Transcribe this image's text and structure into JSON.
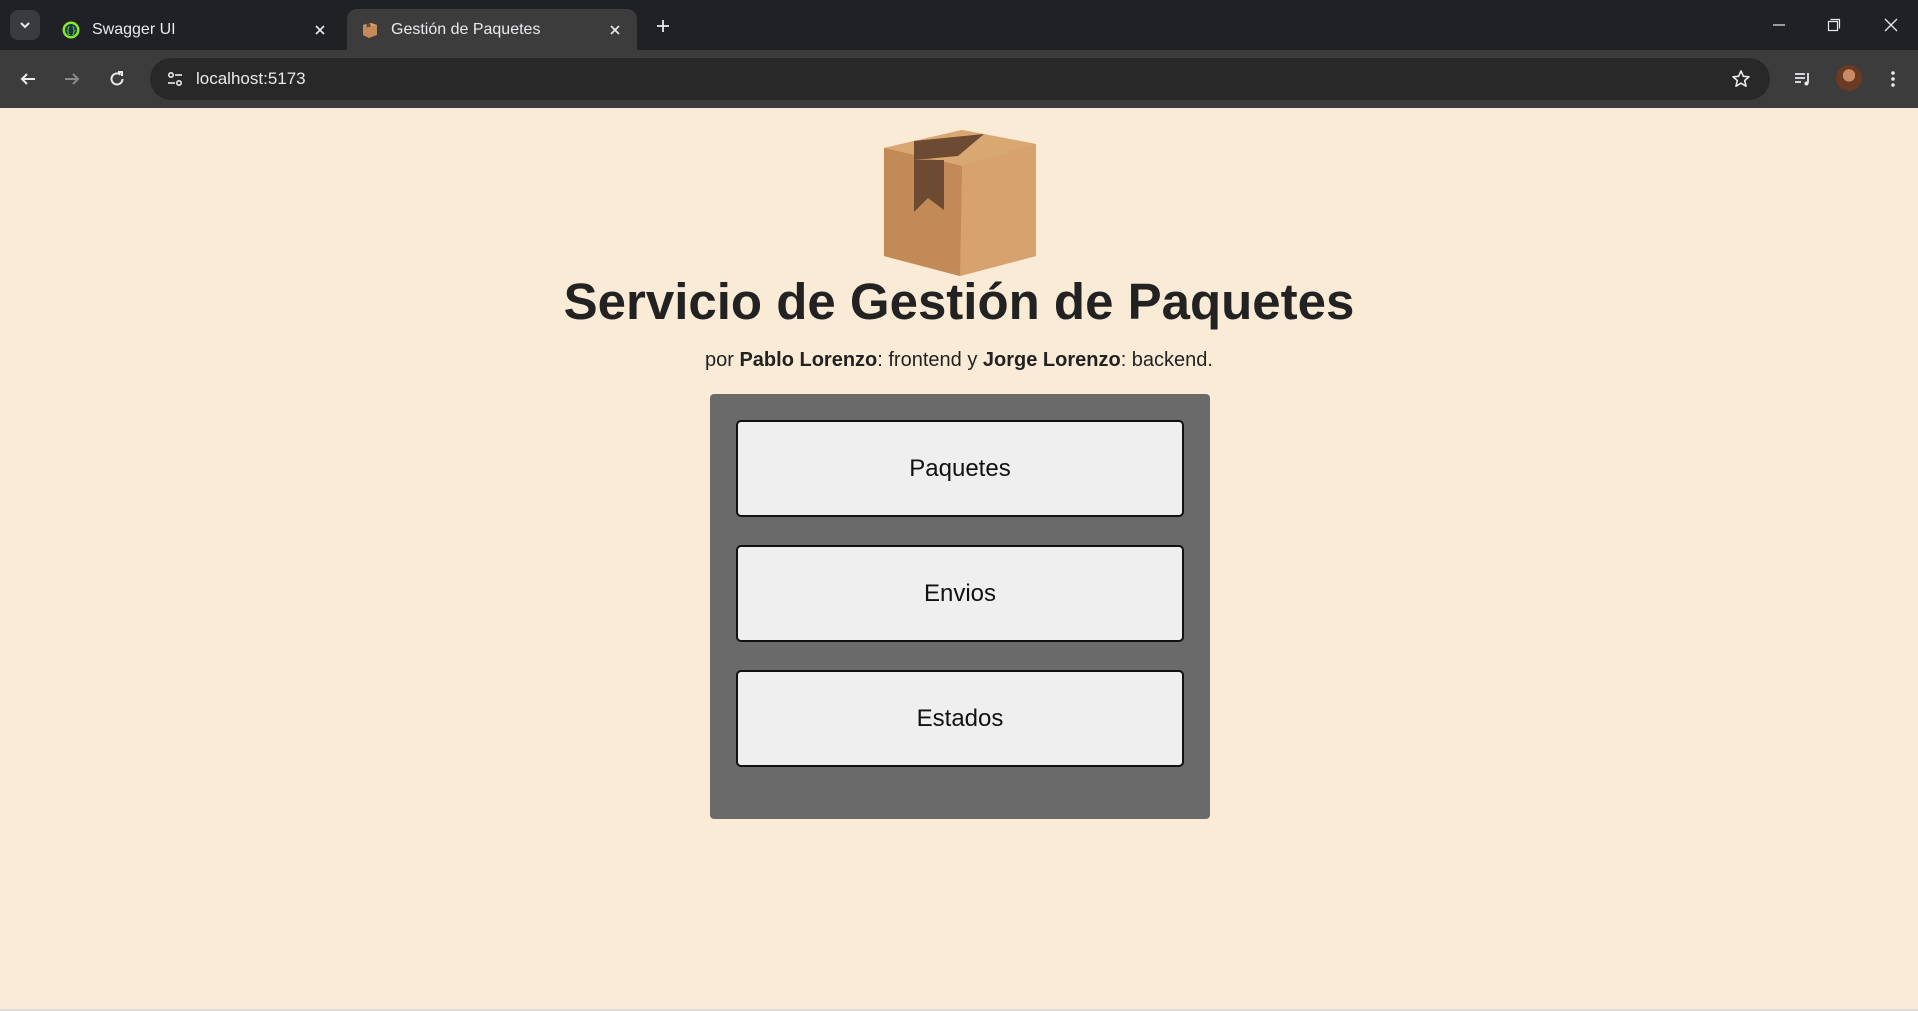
{
  "browser": {
    "tabs": [
      {
        "title": "Swagger UI",
        "active": false
      },
      {
        "title": "Gestión de Paquetes",
        "active": true
      }
    ],
    "url": "localhost:5173"
  },
  "page": {
    "logo_icon": "package-box-icon",
    "title": "Servicio de Gestión de Paquetes",
    "credits": {
      "prefix": "por ",
      "author1": "Pablo Lorenzo",
      "role1": ": frontend y ",
      "author2": "Jorge Lorenzo",
      "role2": ": backend."
    },
    "menu": [
      {
        "label": "Paquetes"
      },
      {
        "label": "Envios"
      },
      {
        "label": "Estados"
      }
    ]
  },
  "colors": {
    "page_background": "#faebd7",
    "panel_background": "#6a6a6a",
    "button_background": "#efefef"
  }
}
